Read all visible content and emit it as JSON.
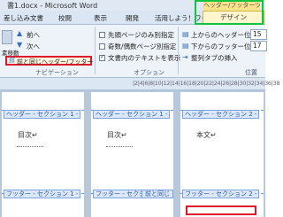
{
  "window": {
    "title": "書1.docx - Microsoft Word",
    "context_tab": "ヘッダー/フッターツール"
  },
  "tabs": [
    "差し込み文書",
    "校閲",
    "表示",
    "開発",
    "活用しよう！ワード",
    "デザイン"
  ],
  "ribbon": {
    "nav": {
      "prev": "前へ",
      "next": "次へ",
      "link_prev": "前と同じヘッダー/フッター",
      "group_label": "ナビゲーション",
      "side_label": "素移動"
    },
    "options": {
      "first_page_diff": "先頭ページのみ別指定",
      "odd_even_diff": "奇数/偶数ページ別指定",
      "show_doc_text": "文書内のテキストを表示",
      "show_doc_text_checked": true,
      "group_label": "オプション"
    },
    "position": {
      "header_from_top": "上からのヘッダー位置:",
      "header_value": "15",
      "footer_from_bottom": "下からのフッター位置:",
      "footer_value": "17",
      "insert_align_tab": "整列タブの挿入",
      "group_label": "位置"
    }
  },
  "ruler": {
    "numbers": "|2|4|6|8|10|12|14|16|18|20|22|24|26|28|30|32|34|36|38"
  },
  "pages": [
    {
      "header": "ヘッダー - セクション 1 -",
      "body": "目次↵",
      "footer": "フッター - セクション 1 -",
      "same_as_prev": ""
    },
    {
      "header": "ヘッダー - セクション 1 -",
      "body": "目次↵",
      "footer": "フッター - セクション 1 -",
      "same_as_prev": "前と同じ"
    },
    {
      "header": "ヘッダー - セクション 2 -",
      "body": "本文↵",
      "footer": "フッター - セクション 2 -",
      "same_as_prev": ""
    }
  ],
  "colors": {
    "highlight_red": "#e0182c",
    "highlight_green": "#12c33e",
    "context_yellow": "#f7e38a"
  }
}
